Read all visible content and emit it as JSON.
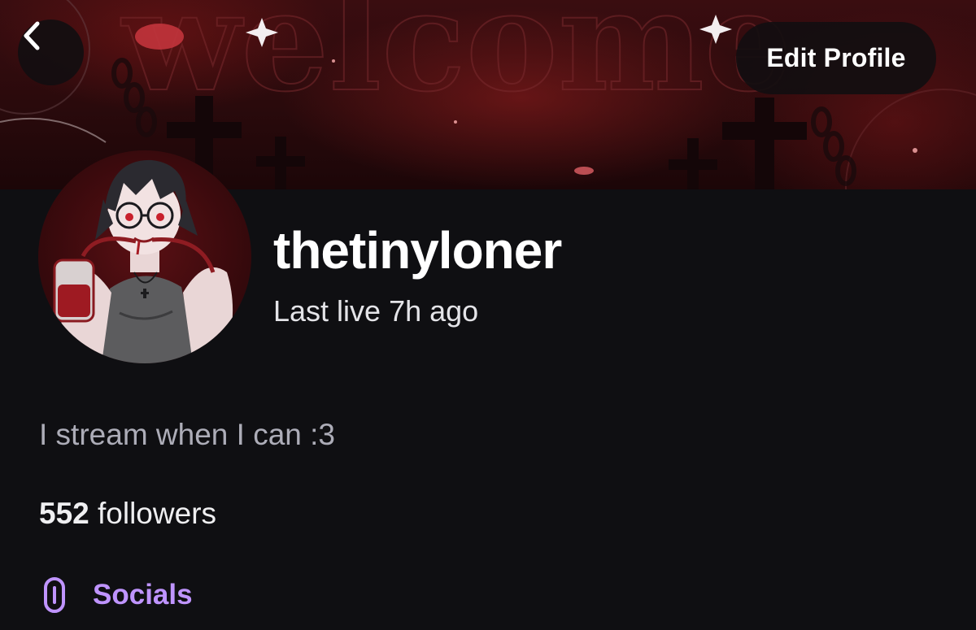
{
  "header": {
    "banner_text": "welcome",
    "back_icon": "chevron-left-icon",
    "edit_profile_label": "Edit Profile"
  },
  "profile": {
    "username": "thetinyloner",
    "last_live": "Last live 7h ago",
    "bio": "I stream when I can :3",
    "followers_count": "552",
    "followers_label": " followers"
  },
  "socials": {
    "icon": "link-icon",
    "label": "Socials"
  },
  "colors": {
    "background": "#0f0f12",
    "accent": "#bf94ff",
    "banner": "#3a0d10",
    "button_bg": "#120e10"
  }
}
